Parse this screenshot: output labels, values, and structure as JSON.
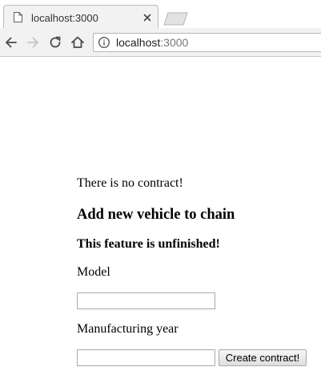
{
  "browser": {
    "tab": {
      "title": "localhost:3000",
      "icon": "page-icon",
      "close_icon": "close-icon"
    },
    "new_tab_icon": "new-tab-icon",
    "nav": {
      "back_icon": "back-arrow-icon",
      "forward_icon": "forward-arrow-icon",
      "reload_icon": "reload-icon",
      "home_icon": "home-icon"
    },
    "address": {
      "host": "localhost",
      "port": ":3000",
      "info_icon": "info-icon"
    }
  },
  "page": {
    "status_message": "There is no contract!",
    "heading": "Add new vehicle to chain",
    "subheading": "This feature is unfinished!",
    "form": {
      "model_label": "Model",
      "model_value": "",
      "year_label": "Manufacturing year",
      "year_value": "",
      "submit_label": "Create contract!"
    }
  },
  "colors": {
    "chrome_background": "#f2f2f2",
    "page_background": "#ffffff",
    "text": "#000000"
  }
}
